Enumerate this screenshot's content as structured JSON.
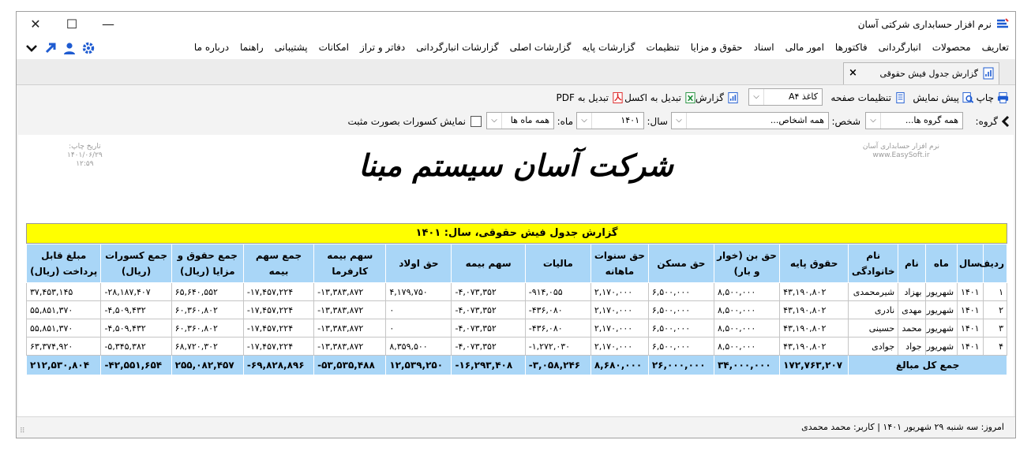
{
  "app": {
    "title": "نرم افزار حسابداری شرکتی آسان"
  },
  "window_controls": {
    "minimize": "—",
    "maximize": "☐",
    "close": "✕"
  },
  "menu": [
    "تعاریف",
    "محصولات",
    "انبارگردانی",
    "فاکتورها",
    "امور مالی",
    "اسناد",
    "حقوق و مزایا",
    "تنظیمات",
    "گزارشات پایه",
    "گزارشات اصلی",
    "گزارشات انبارگردانی",
    "دفاتر و تراز",
    "امکانات",
    "پشتیبانی",
    "راهنما",
    "درباره ما"
  ],
  "tab": {
    "label": "گزارش جدول فیش حقوقی",
    "close": "×"
  },
  "toolbar": {
    "print": "چاپ",
    "preview": "پیش نمایش",
    "page_setup": "تنظیمات صفحه",
    "paper": "کاغذ A۴",
    "report": "گزارش",
    "excel": "تبدیل به اکسل",
    "pdf": "تبدیل به PDF"
  },
  "filters": {
    "group_label": "گروه:",
    "group_value": "همه گروه ها...",
    "person_label": "شخص:",
    "person_value": "همه اشخاص...",
    "year_label": "سال:",
    "year_value": "۱۴۰۱",
    "month_label": "ماه:",
    "month_value": "همه ماه ها",
    "deductions_label": "نمایش کسورات بصورت مثبت"
  },
  "report": {
    "left_header": [
      "تاریخ چاپ:",
      "۱۴۰۱/۰۶/۲۹",
      "۱۲:۵۹"
    ],
    "right_header": [
      "نرم افزار حسابداری آسان",
      "www.EasySoft.ir"
    ],
    "company": "شرکت آسان سیستم مبنا",
    "title": "گزارش جدول فیش حقوقی، سال: ۱۴۰۱",
    "columns": [
      "ردیف",
      "سال",
      "ماه",
      "نام",
      "نام خانوادگی",
      "حقوق پایه",
      "حق بن (خوار و بار)",
      "حق مسکن",
      "حق سنوات ماهانه",
      "مالیات",
      "سهم بیمه",
      "حق اولاد",
      "سهم بیمه کارفرما",
      "جمع سهم بیمه",
      "جمع حقوق و مزایا (ریال)",
      "جمع کسورات (ریال)",
      "مبلغ قابل پرداخت (ریال)"
    ],
    "rows": [
      [
        "۱",
        "۱۴۰۱",
        "شهریور",
        "بهزاد",
        "شیرمحمدی",
        "۴۳,۱۹۰,۸۰۲",
        "۸,۵۰۰,۰۰۰",
        "۶,۵۰۰,۰۰۰",
        "۲,۱۷۰,۰۰۰",
        "-۹۱۴,۰۵۵",
        "-۴,۰۷۳,۳۵۲",
        "۴,۱۷۹,۷۵۰",
        "-۱۳,۳۸۳,۸۷۲",
        "-۱۷,۴۵۷,۲۲۴",
        "۶۵,۶۴۰,۵۵۲",
        "-۲۸,۱۸۷,۴۰۷",
        "۳۷,۴۵۳,۱۴۵"
      ],
      [
        "۲",
        "۱۴۰۱",
        "شهریور",
        "مهدی",
        "نادری",
        "۴۳,۱۹۰,۸۰۲",
        "۸,۵۰۰,۰۰۰",
        "۶,۵۰۰,۰۰۰",
        "۲,۱۷۰,۰۰۰",
        "-۴۳۶,۰۸۰",
        "-۴,۰۷۳,۳۵۲",
        "۰",
        "-۱۳,۳۸۳,۸۷۲",
        "-۱۷,۴۵۷,۲۲۴",
        "۶۰,۳۶۰,۸۰۲",
        "-۴,۵۰۹,۴۳۲",
        "۵۵,۸۵۱,۳۷۰"
      ],
      [
        "۳",
        "۱۴۰۱",
        "شهریور",
        "محمد",
        "حسینی",
        "۴۳,۱۹۰,۸۰۲",
        "۸,۵۰۰,۰۰۰",
        "۶,۵۰۰,۰۰۰",
        "۲,۱۷۰,۰۰۰",
        "-۴۳۶,۰۸۰",
        "-۴,۰۷۳,۳۵۲",
        "۰",
        "-۱۳,۳۸۳,۸۷۲",
        "-۱۷,۴۵۷,۲۲۴",
        "۶۰,۳۶۰,۸۰۲",
        "-۴,۵۰۹,۴۳۲",
        "۵۵,۸۵۱,۳۷۰"
      ],
      [
        "۴",
        "۱۴۰۱",
        "شهریور",
        "جواد",
        "جوادی",
        "۴۳,۱۹۰,۸۰۲",
        "۸,۵۰۰,۰۰۰",
        "۶,۵۰۰,۰۰۰",
        "۲,۱۷۰,۰۰۰",
        "-۱,۲۷۲,۰۳۰",
        "-۴,۰۷۳,۳۵۲",
        "۸,۳۵۹,۵۰۰",
        "-۱۳,۳۸۳,۸۷۲",
        "-۱۷,۴۵۷,۲۲۴",
        "۶۸,۷۲۰,۳۰۲",
        "-۵,۳۴۵,۳۸۲",
        "۶۳,۳۷۴,۹۲۰"
      ]
    ],
    "total_label": "جمع کل مبالغ",
    "totals": [
      "۱۷۲,۷۶۳,۲۰۷",
      "۳۴,۰۰۰,۰۰۰",
      "۲۶,۰۰۰,۰۰۰",
      "۸,۶۸۰,۰۰۰",
      "-۳,۰۵۸,۲۴۶",
      "-۱۶,۲۹۳,۴۰۸",
      "۱۲,۵۳۹,۲۵۰",
      "-۵۳,۵۳۵,۴۸۸",
      "-۶۹,۸۲۸,۸۹۶",
      "۲۵۵,۰۸۲,۴۵۷",
      "-۴۲,۵۵۱,۶۵۴",
      "۲۱۲,۵۳۰,۸۰۴"
    ]
  },
  "status": {
    "text": "امروز: سه شنبه ۲۹ شهریور ۱۴۰۱   |   کاربر: محمد محمدی"
  },
  "colors": {
    "accent": "#1e5bd1",
    "header_blue": "#a9d6f7",
    "title_yellow": "#ffff00"
  }
}
